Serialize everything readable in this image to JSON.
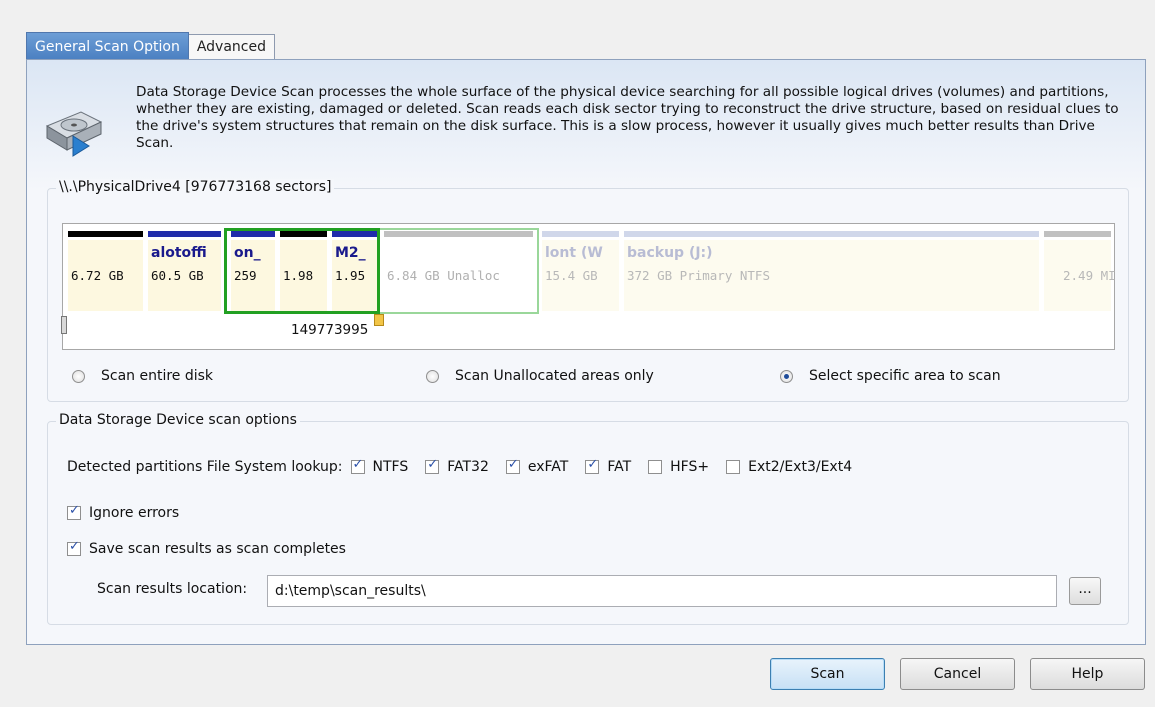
{
  "tabs": [
    "General Scan Option",
    "Advanced"
  ],
  "description": "Data Storage Device Scan processes the whole surface of the physical device  searching for all possible logical drives (volumes) and partitions, whether they are existing, damaged or deleted. Scan reads each disk sector trying to reconstruct the drive structure, based on residual clues to the drive's system structures that remain on the disk surface. This is a slow process, however it usually gives much better results than Drive Scan.",
  "device_group": {
    "title": "\\\\.\\PhysicalDrive4 [976773168 sectors]",
    "sector_label": "149773995",
    "partitions": [
      {
        "name": "",
        "size": "6.72 GB"
      },
      {
        "name": "alotoffi",
        "size": "60.5 GB"
      },
      {
        "name": "on_",
        "size": "259"
      },
      {
        "name": "",
        "size": "1.98"
      },
      {
        "name": "M2_",
        "size": "1.95"
      },
      {
        "name": "",
        "size": "6.84 GB  Unalloc"
      },
      {
        "name": "lont (W",
        "size": "15.4 GB"
      },
      {
        "name": "backup (J:)",
        "size": "372 GB Primary NTFS"
      },
      {
        "name": "",
        "size": "2.49 MI"
      }
    ],
    "scan_modes": [
      {
        "label": "Scan entire disk",
        "selected": false
      },
      {
        "label": "Scan Unallocated areas only",
        "selected": false
      },
      {
        "label": "Select specific area to scan",
        "selected": true
      }
    ]
  },
  "options_group": {
    "title": "Data Storage Device scan options",
    "fs_lookup_label": "Detected partitions File System lookup:",
    "fs": [
      {
        "label": "NTFS",
        "checked": true
      },
      {
        "label": "FAT32",
        "checked": true
      },
      {
        "label": "exFAT",
        "checked": true
      },
      {
        "label": "FAT",
        "checked": true
      },
      {
        "label": "HFS+",
        "checked": false
      },
      {
        "label": "Ext2/Ext3/Ext4",
        "checked": false
      }
    ],
    "ignore_errors": {
      "label": "Ignore errors",
      "checked": true
    },
    "save_results": {
      "label": "Save scan results as scan completes",
      "checked": true
    },
    "location_label": "Scan results location:",
    "location_value": "d:\\temp\\scan_results\\",
    "browse_label": "..."
  },
  "buttons": {
    "scan": "Scan",
    "cancel": "Cancel",
    "help": "Help"
  },
  "colors": {
    "primary_bar": "#000000",
    "logical_bar": "#1f2bab",
    "unalloc_bar": "#c0c0c0",
    "selection": "#22a022",
    "accent": "#4a7fc1"
  }
}
